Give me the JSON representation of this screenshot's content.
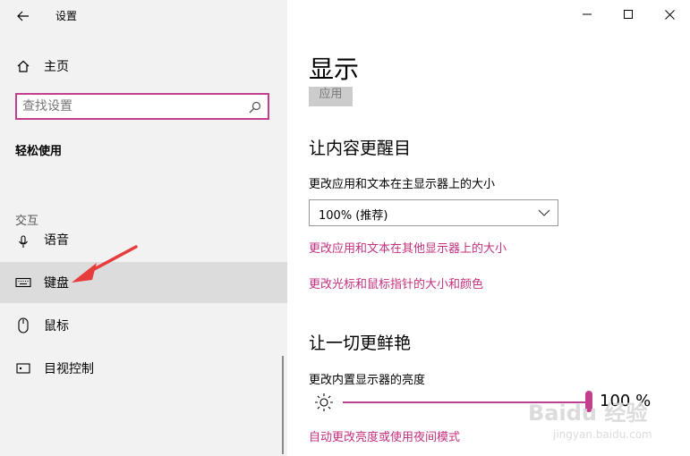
{
  "window": {
    "title": "设置",
    "controls": [
      "minimize",
      "maximize",
      "close"
    ]
  },
  "sidebar": {
    "home_label": "主页",
    "search_placeholder": "查找设置",
    "section_title": "轻松使用",
    "group_label": "交互",
    "items": [
      {
        "label": "语音",
        "icon": "microphone-icon"
      },
      {
        "label": "键盘",
        "icon": "keyboard-icon",
        "selected": true
      },
      {
        "label": "鼠标",
        "icon": "mouse-icon"
      },
      {
        "label": "目视控制",
        "icon": "eye-control-icon"
      }
    ]
  },
  "main": {
    "page_title": "显示",
    "apply_label": "应用",
    "section1_title": "让内容更醒目",
    "scale_label": "更改应用和文本在主显示器上的大小",
    "scale_value": "100% (推荐)",
    "link_other_displays": "更改应用和文本在其他显示器上的大小",
    "link_cursor": "更改光标和鼠标指针的大小和颜色",
    "section2_title": "让一切更鲜艳",
    "brightness_label": "更改内置显示器的亮度",
    "brightness_value": "100 %",
    "brightness_fraction": 1.0,
    "link_night_mode": "自动更改亮度或使用夜间模式"
  },
  "watermark": {
    "text": "Baidu 经验",
    "url_text": "jingyan.baidu.com"
  },
  "colors": {
    "accent": "#c23f8e",
    "link": "#c2307f",
    "sidebar_bg": "#f2f2f2",
    "selected_bg": "#dcdcdc",
    "annotation_arrow": "#e63c3c"
  }
}
